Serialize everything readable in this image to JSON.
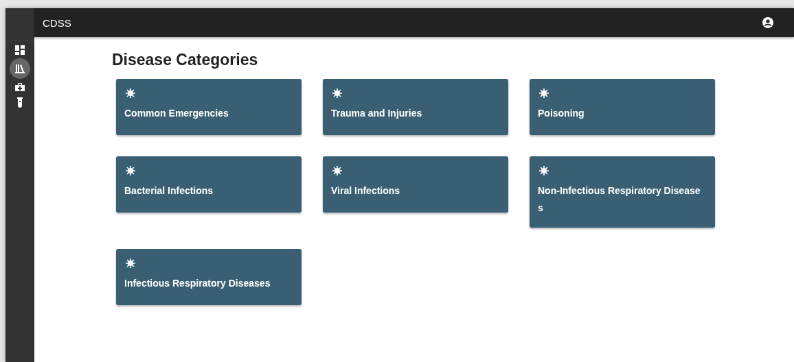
{
  "app_bar": {
    "title": "CDSS"
  },
  "sidebar": {
    "items": [
      {
        "kind": "dashboard",
        "selected": false
      },
      {
        "kind": "library",
        "selected": true
      },
      {
        "kind": "medkit",
        "selected": false
      },
      {
        "kind": "tube",
        "selected": false
      }
    ]
  },
  "page": {
    "heading": "Disease Categories",
    "categories": [
      {
        "label": "Common Emergencies"
      },
      {
        "label": "Trauma and Injuries"
      },
      {
        "label": "Poisoning"
      },
      {
        "label": "Bacterial Infections"
      },
      {
        "label": "Viral Infections"
      },
      {
        "label": "Non-Infectious Respiratory Diseases"
      },
      {
        "label": "Infectious Respiratory Diseases"
      }
    ]
  }
}
